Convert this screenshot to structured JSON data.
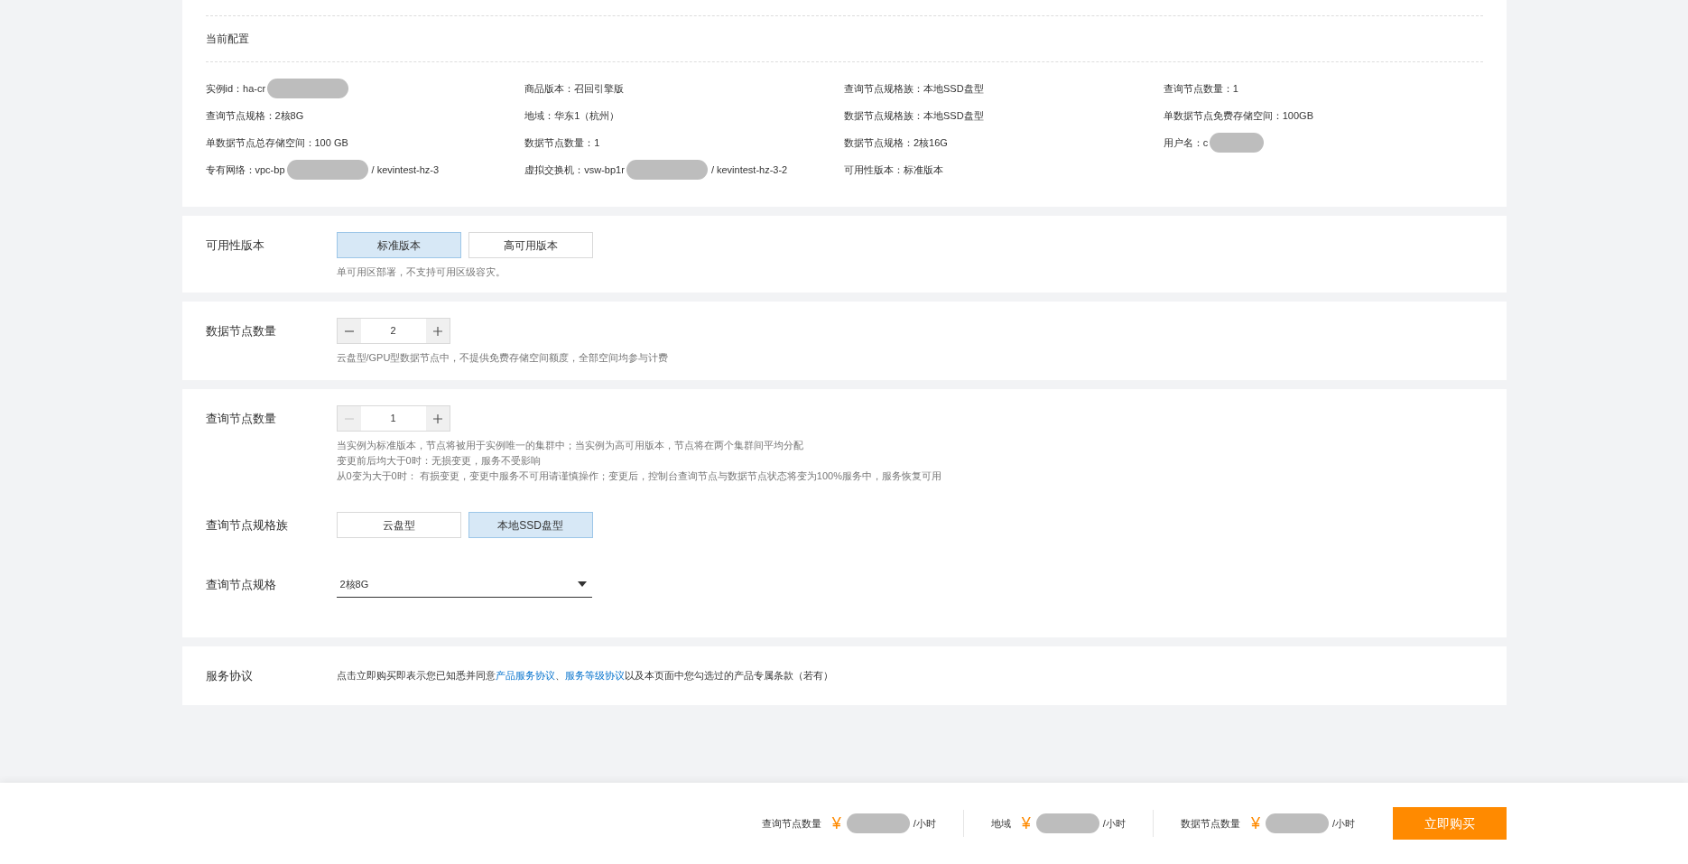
{
  "config": {
    "title": "当前配置",
    "items": [
      {
        "label": "实例id：",
        "value": "ha-cr",
        "redacted": true
      },
      {
        "label": "商品版本：",
        "value": "召回引擎版",
        "redacted": false
      },
      {
        "label": "查询节点规格族：",
        "value": "本地SSD盘型",
        "redacted": false
      },
      {
        "label": "查询节点数量：",
        "value": "1",
        "redacted": false
      },
      {
        "label": "查询节点规格：",
        "value": "2核8G",
        "redacted": false
      },
      {
        "label": "地域：",
        "value": "华东1（杭州）",
        "redacted": false
      },
      {
        "label": "数据节点规格族：",
        "value": "本地SSD盘型",
        "redacted": false
      },
      {
        "label": "单数据节点免费存储空间：",
        "value": "100GB",
        "redacted": false
      },
      {
        "label": "单数据节点总存储空间：",
        "value": "100 GB",
        "redacted": false
      },
      {
        "label": "数据节点数量：",
        "value": "1",
        "redacted": false
      },
      {
        "label": "数据节点规格：",
        "value": "2核16G",
        "redacted": false
      },
      {
        "label": "用户名：",
        "value": "c",
        "redacted": true
      },
      {
        "label": "专有网络：",
        "value": "vpc-bp",
        "redacted": true,
        "suffix": "/ kevintest-hz-3"
      },
      {
        "label": "虚拟交换机：",
        "value": "vsw-bp1r",
        "redacted": true,
        "suffix": "/ kevintest-hz-3-2"
      },
      {
        "label": "可用性版本：",
        "value": "标准版本",
        "redacted": false
      }
    ]
  },
  "availability": {
    "label": "可用性版本",
    "options": [
      {
        "label": "标准版本",
        "selected": true
      },
      {
        "label": "高可用版本",
        "selected": false
      }
    ],
    "hints": [
      "单可用区部署，不支持可用区级容灾。"
    ]
  },
  "data_nodes": {
    "label": "数据节点数量",
    "stepper": {
      "value": "2",
      "minus_disabled": false
    },
    "hints": [
      "云盘型/GPU型数据节点中，不提供免费存储空间额度，全部空间均参与计费"
    ]
  },
  "query_nodes": {
    "label": "查询节点数量",
    "stepper": {
      "value": "1",
      "minus_disabled": true
    },
    "hints": [
      "当实例为标准版本，节点将被用于实例唯一的集群中；当实例为高可用版本，节点将在两个集群间平均分配",
      "变更前后均大于0时：无损变更，服务不受影响",
      "从0变为大于0时： 有损变更，变更中服务不可用请谨慎操作；变更后，控制台查询节点与数据节点状态将变为100%服务中，服务恢复可用"
    ]
  },
  "query_spec_family": {
    "label": "查询节点规格族",
    "options": [
      {
        "label": "云盘型",
        "selected": false
      },
      {
        "label": "本地SSD盘型",
        "selected": true
      }
    ]
  },
  "query_spec": {
    "label": "查询节点规格",
    "value": "2核8G"
  },
  "agreement": {
    "label": "服务协议",
    "parts": [
      {
        "kind": "text",
        "text": "点击立即购买即表示您已知悉并同意"
      },
      {
        "kind": "link",
        "text": "产品服务协议"
      },
      {
        "kind": "text",
        "text": "、"
      },
      {
        "kind": "link",
        "text": "服务等级协议"
      },
      {
        "kind": "text",
        "text": "以及本页面中您勾选过的产品专属条款（若有）"
      }
    ]
  },
  "footer": {
    "prices": [
      {
        "label": "查询节点数量",
        "currency": "¥",
        "unit": "/小时"
      },
      {
        "label": "地域",
        "currency": "¥",
        "unit": "/小时"
      },
      {
        "label": "数据节点数量",
        "currency": "¥",
        "unit": "/小时"
      }
    ],
    "buy_button": "立即购买"
  }
}
